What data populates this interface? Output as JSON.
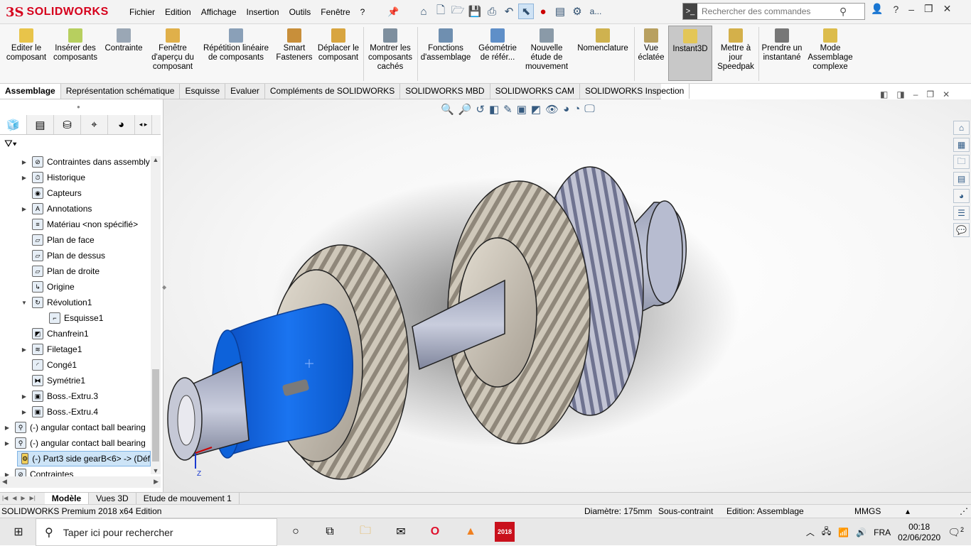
{
  "app": {
    "logo_ds": "3S",
    "logo_name": "SOLIDWORKS"
  },
  "menu": [
    "Fichier",
    "Edition",
    "Affichage",
    "Insertion",
    "Outils",
    "Fenêtre",
    "?"
  ],
  "search": {
    "placeholder": "Rechercher des commandes"
  },
  "qat_trailing": "a...",
  "ribbon": [
    {
      "label": "Editer le composant"
    },
    {
      "label": "Insérer des composants"
    },
    {
      "label": "Contrainte"
    },
    {
      "label": "Fenêtre d'aperçu du composant"
    },
    {
      "label": "Répétition linéaire de composants"
    },
    {
      "label": "Smart Fasteners"
    },
    {
      "label": "Déplacer le composant"
    },
    {
      "label": "Montrer les composants cachés"
    },
    {
      "label": "Fonctions d'assemblage"
    },
    {
      "label": "Géométrie de référ..."
    },
    {
      "label": "Nouvelle étude de mouvement"
    },
    {
      "label": "Nomenclature"
    },
    {
      "label": "Vue éclatée"
    },
    {
      "label": "Instant3D"
    },
    {
      "label": "Mettre à jour Speedpak"
    },
    {
      "label": "Prendre un instantané"
    },
    {
      "label": "Mode Assemblage complexe"
    }
  ],
  "tabs": [
    "Assemblage",
    "Représentation schématique",
    "Esquisse",
    "Evaluer",
    "Compléments de SOLIDWORKS",
    "SOLIDWORKS MBD",
    "SOLIDWORKS CAM",
    "SOLIDWORKS Inspection"
  ],
  "tree": [
    {
      "label": "Contraintes dans assembly"
    },
    {
      "label": "Historique"
    },
    {
      "label": "Capteurs"
    },
    {
      "label": "Annotations"
    },
    {
      "label": "Matériau <non spécifié>"
    },
    {
      "label": "Plan de face"
    },
    {
      "label": "Plan de dessus"
    },
    {
      "label": "Plan de droite"
    },
    {
      "label": "Origine"
    },
    {
      "label": "Révolution1"
    },
    {
      "label": "Esquisse1"
    },
    {
      "label": "Chanfrein1"
    },
    {
      "label": "Filetage1"
    },
    {
      "label": "Congé1"
    },
    {
      "label": "Symétrie1"
    },
    {
      "label": "Boss.-Extru.3"
    },
    {
      "label": "Boss.-Extru.4"
    },
    {
      "label": "(-) angular contact ball bearing"
    },
    {
      "label": "(-) angular contact ball bearing"
    },
    {
      "label": "(-) Part3 side gearB<6> -> (Déf"
    },
    {
      "label": "Contraintes"
    }
  ],
  "bottom_tabs": [
    "Modèle",
    "Vues 3D",
    "Etude de mouvement 1"
  ],
  "status": {
    "product": "SOLIDWORKS Premium 2018 x64 Edition",
    "diameter": "Diamètre: 175mm",
    "constraint": "Sous-contraint",
    "edition": "Edition: Assemblage",
    "units": "MMGS"
  },
  "taskbar": {
    "search": "Taper ici pour rechercher",
    "lang": "FRA",
    "time": "00:18",
    "date": "02/06/2020",
    "notif": "2",
    "sw_year": "2018"
  },
  "colors": {
    "accent": "#0a5fd6",
    "selection": "#cde4f7",
    "brand": "#d6001c"
  }
}
